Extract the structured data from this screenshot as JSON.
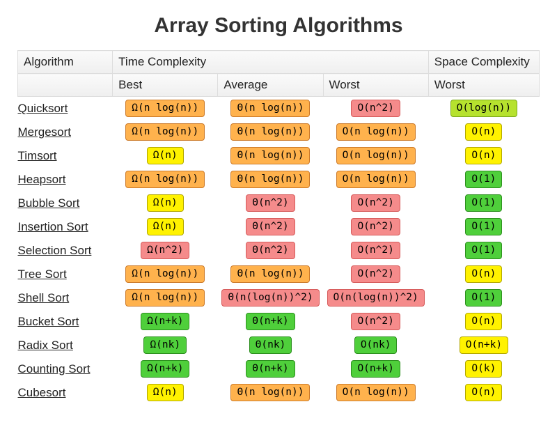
{
  "title": "Array Sorting Algorithms",
  "headers": {
    "algorithm": "Algorithm",
    "time_complexity": "Time Complexity",
    "space_complexity": "Space Complexity",
    "best": "Best",
    "average": "Average",
    "worst_time": "Worst",
    "worst_space": "Worst"
  },
  "rows": [
    {
      "name": "Quicksort",
      "best": {
        "text": "Ω(n log(n))",
        "color": "orange"
      },
      "average": {
        "text": "Θ(n log(n))",
        "color": "orange"
      },
      "worst": {
        "text": "O(n^2)",
        "color": "red"
      },
      "space": {
        "text": "O(log(n))",
        "color": "yellowgreen"
      }
    },
    {
      "name": "Mergesort",
      "best": {
        "text": "Ω(n log(n))",
        "color": "orange"
      },
      "average": {
        "text": "Θ(n log(n))",
        "color": "orange"
      },
      "worst": {
        "text": "O(n log(n))",
        "color": "orange"
      },
      "space": {
        "text": "O(n)",
        "color": "yellow"
      }
    },
    {
      "name": "Timsort",
      "best": {
        "text": "Ω(n)",
        "color": "yellow"
      },
      "average": {
        "text": "Θ(n log(n))",
        "color": "orange"
      },
      "worst": {
        "text": "O(n log(n))",
        "color": "orange"
      },
      "space": {
        "text": "O(n)",
        "color": "yellow"
      }
    },
    {
      "name": "Heapsort",
      "best": {
        "text": "Ω(n log(n))",
        "color": "orange"
      },
      "average": {
        "text": "Θ(n log(n))",
        "color": "orange"
      },
      "worst": {
        "text": "O(n log(n))",
        "color": "orange"
      },
      "space": {
        "text": "O(1)",
        "color": "green"
      }
    },
    {
      "name": "Bubble Sort",
      "best": {
        "text": "Ω(n)",
        "color": "yellow"
      },
      "average": {
        "text": "Θ(n^2)",
        "color": "red"
      },
      "worst": {
        "text": "O(n^2)",
        "color": "red"
      },
      "space": {
        "text": "O(1)",
        "color": "green"
      }
    },
    {
      "name": "Insertion Sort",
      "best": {
        "text": "Ω(n)",
        "color": "yellow"
      },
      "average": {
        "text": "Θ(n^2)",
        "color": "red"
      },
      "worst": {
        "text": "O(n^2)",
        "color": "red"
      },
      "space": {
        "text": "O(1)",
        "color": "green"
      }
    },
    {
      "name": "Selection Sort",
      "best": {
        "text": "Ω(n^2)",
        "color": "red"
      },
      "average": {
        "text": "Θ(n^2)",
        "color": "red"
      },
      "worst": {
        "text": "O(n^2)",
        "color": "red"
      },
      "space": {
        "text": "O(1)",
        "color": "green"
      }
    },
    {
      "name": "Tree Sort",
      "best": {
        "text": "Ω(n log(n))",
        "color": "orange"
      },
      "average": {
        "text": "Θ(n log(n))",
        "color": "orange"
      },
      "worst": {
        "text": "O(n^2)",
        "color": "red"
      },
      "space": {
        "text": "O(n)",
        "color": "yellow"
      }
    },
    {
      "name": "Shell Sort",
      "best": {
        "text": "Ω(n log(n))",
        "color": "orange"
      },
      "average": {
        "text": "Θ(n(log(n))^2)",
        "color": "red"
      },
      "worst": {
        "text": "O(n(log(n))^2)",
        "color": "red"
      },
      "space": {
        "text": "O(1)",
        "color": "green"
      }
    },
    {
      "name": "Bucket Sort",
      "best": {
        "text": "Ω(n+k)",
        "color": "green"
      },
      "average": {
        "text": "Θ(n+k)",
        "color": "green"
      },
      "worst": {
        "text": "O(n^2)",
        "color": "red"
      },
      "space": {
        "text": "O(n)",
        "color": "yellow"
      }
    },
    {
      "name": "Radix Sort",
      "best": {
        "text": "Ω(nk)",
        "color": "green"
      },
      "average": {
        "text": "Θ(nk)",
        "color": "green"
      },
      "worst": {
        "text": "O(nk)",
        "color": "green"
      },
      "space": {
        "text": "O(n+k)",
        "color": "yellow"
      }
    },
    {
      "name": "Counting Sort",
      "best": {
        "text": "Ω(n+k)",
        "color": "green"
      },
      "average": {
        "text": "Θ(n+k)",
        "color": "green"
      },
      "worst": {
        "text": "O(n+k)",
        "color": "green"
      },
      "space": {
        "text": "O(k)",
        "color": "yellow"
      }
    },
    {
      "name": "Cubesort",
      "best": {
        "text": "Ω(n)",
        "color": "yellow"
      },
      "average": {
        "text": "Θ(n log(n))",
        "color": "orange"
      },
      "worst": {
        "text": "O(n log(n))",
        "color": "orange"
      },
      "space": {
        "text": "O(n)",
        "color": "yellow"
      }
    }
  ]
}
